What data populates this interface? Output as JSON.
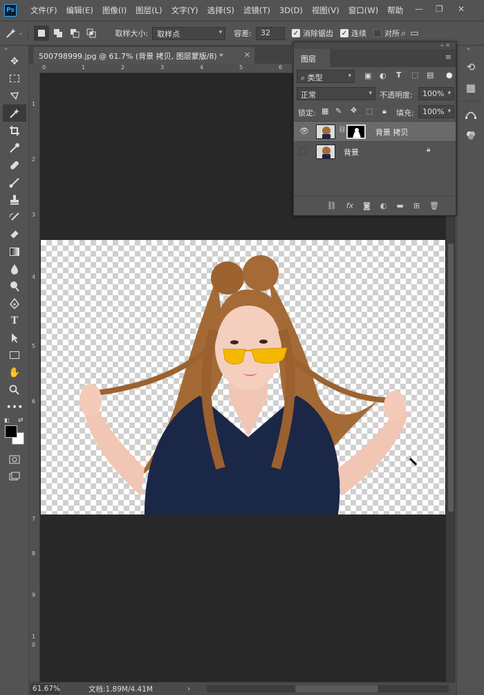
{
  "app": {
    "logo": "Ps"
  },
  "menu": [
    "文件(F)",
    "编辑(E)",
    "图像(I)",
    "图层(L)",
    "文字(Y)",
    "选择(S)",
    "滤镜(T)",
    "3D(D)",
    "视图(V)",
    "窗口(W)",
    "帮助"
  ],
  "options": {
    "sample_size_label": "取样大小:",
    "sample_size_value": "取样点",
    "tolerance_label": "容差:",
    "tolerance_value": "32",
    "antialias_label": "消除锯齿",
    "contiguous_label": "连续",
    "all_layers_label": "对所"
  },
  "document": {
    "tab_title": "500798999.jpg @ 61.7% (背景 拷贝, 图层蒙版/8) *",
    "zoom": "61.67%",
    "doc_info": "文档:1.89M/4.41M",
    "ruler_top": [
      "0",
      "1",
      "2",
      "3",
      "4",
      "5",
      "6"
    ],
    "ruler_left": [
      "1",
      "2",
      "3",
      "4",
      "5",
      "6",
      "7",
      "8",
      "9",
      "1",
      "0"
    ]
  },
  "layers_panel": {
    "title": "图层",
    "filter_kind": "类型",
    "blend_mode": "正常",
    "opacity_label": "不透明度:",
    "opacity_value": "100%",
    "lock_label": "锁定:",
    "fill_label": "填充:",
    "fill_value": "100%",
    "layers": [
      {
        "name": "背景 拷贝",
        "visible": true,
        "active": true,
        "has_mask": true
      },
      {
        "name": "背景",
        "visible": false,
        "active": false,
        "locked": true
      }
    ],
    "footer_icons": [
      "link-icon",
      "fx-icon",
      "mask-icon",
      "adjustment-icon",
      "group-icon",
      "new-layer-icon",
      "trash-icon"
    ]
  },
  "colors": {
    "accent": "#31a8ff",
    "ui_bg": "#535353",
    "canvas_bg": "#282828"
  }
}
